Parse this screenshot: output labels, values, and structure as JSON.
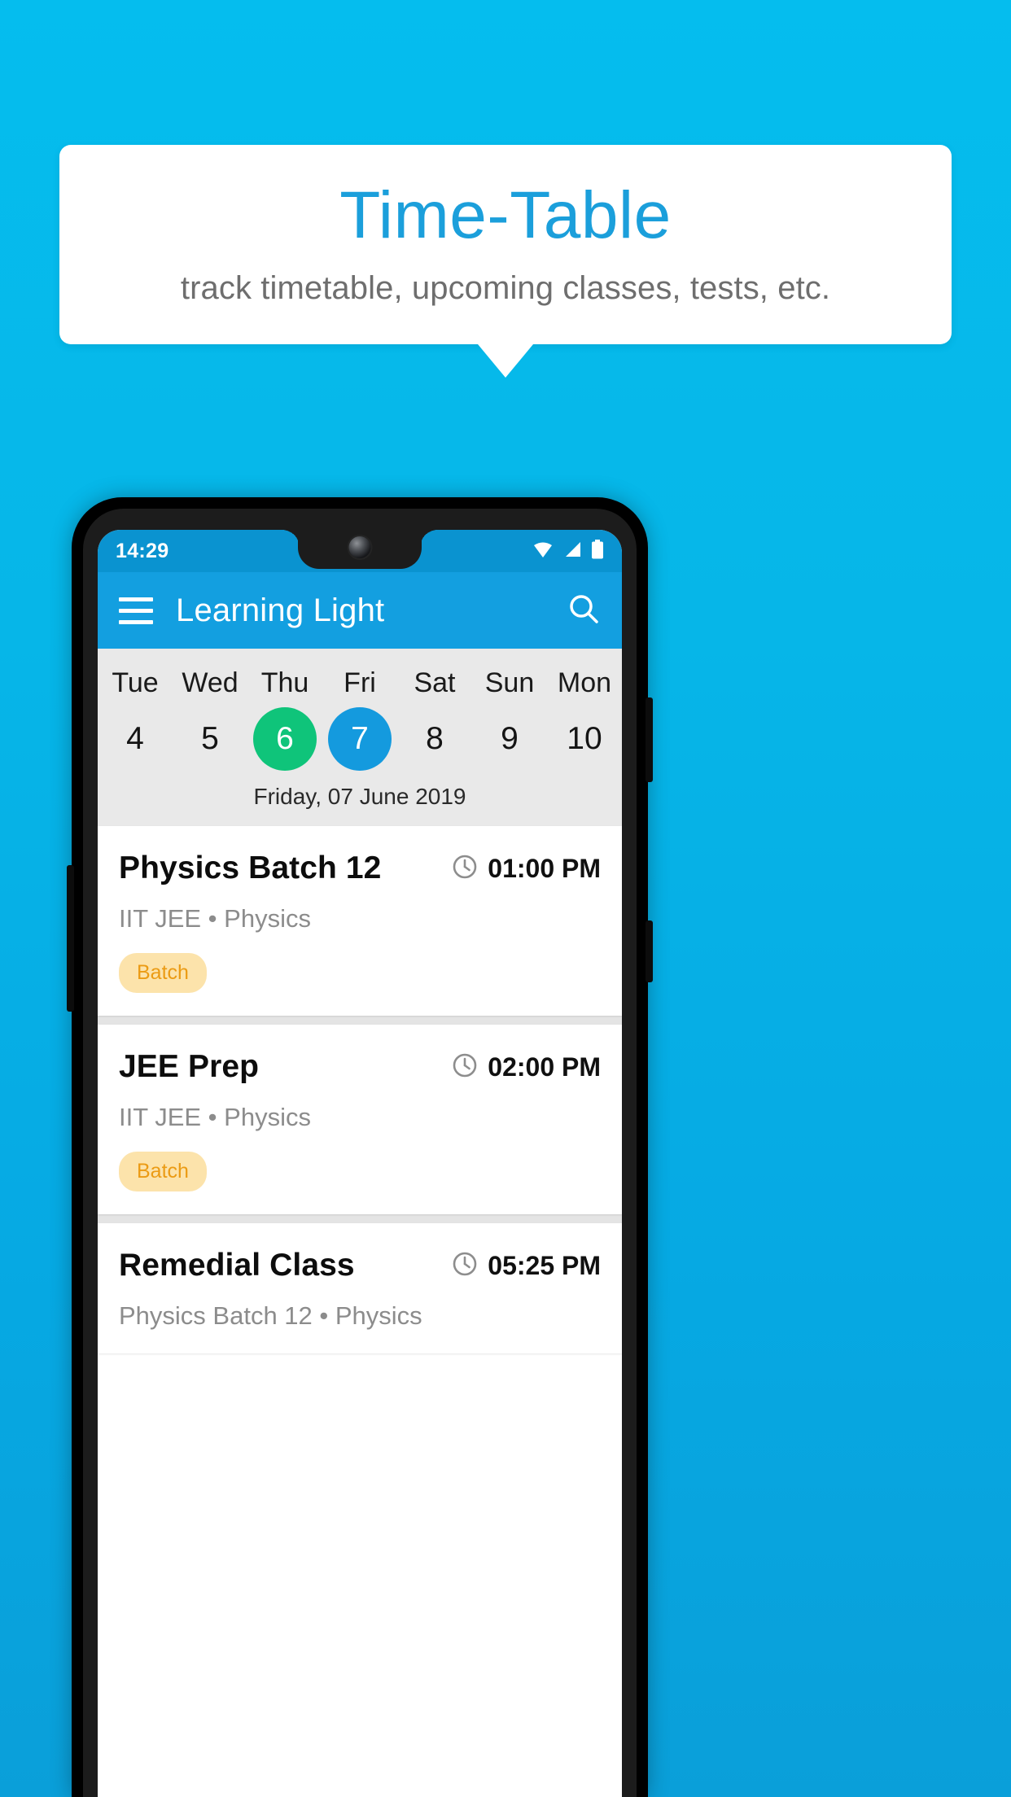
{
  "promo": {
    "title": "Time-Table",
    "subtitle": "track timetable, upcoming classes, tests, etc.",
    "title_color": "#1b9fdb",
    "background_color": "#06b6e8"
  },
  "phone": {
    "status_bar": {
      "time": "14:29",
      "icons": [
        "wifi-icon",
        "cellular-signal-icon",
        "battery-icon"
      ],
      "background_color": "#0a93d0"
    },
    "app_bar": {
      "menu_icon": "hamburger-menu-icon",
      "title": "Learning Light",
      "search_icon": "search-icon",
      "background_color": "#139fe0"
    },
    "week_strip": {
      "days": [
        {
          "day": "Tue",
          "date": "4",
          "state": "normal"
        },
        {
          "day": "Wed",
          "date": "5",
          "state": "normal"
        },
        {
          "day": "Thu",
          "date": "6",
          "state": "today"
        },
        {
          "day": "Fri",
          "date": "7",
          "state": "selected"
        },
        {
          "day": "Sat",
          "date": "8",
          "state": "normal"
        },
        {
          "day": "Sun",
          "date": "9",
          "state": "normal"
        },
        {
          "day": "Mon",
          "date": "10",
          "state": "normal"
        }
      ],
      "selected_date_label": "Friday, 07 June 2019",
      "today_color": "#0fc47a",
      "selected_color": "#149ade"
    },
    "schedule": [
      {
        "title": "Physics Batch 12",
        "time": "01:00 PM",
        "subtitle": "IIT JEE • Physics",
        "badge": "Batch",
        "clock_icon": "clock-icon"
      },
      {
        "title": "JEE Prep",
        "time": "02:00 PM",
        "subtitle": "IIT JEE • Physics",
        "badge": "Batch",
        "clock_icon": "clock-icon"
      },
      {
        "title": "Remedial Class",
        "time": "05:25 PM",
        "subtitle": "Physics Batch 12 • Physics",
        "badge": "",
        "clock_icon": "clock-icon"
      }
    ]
  }
}
